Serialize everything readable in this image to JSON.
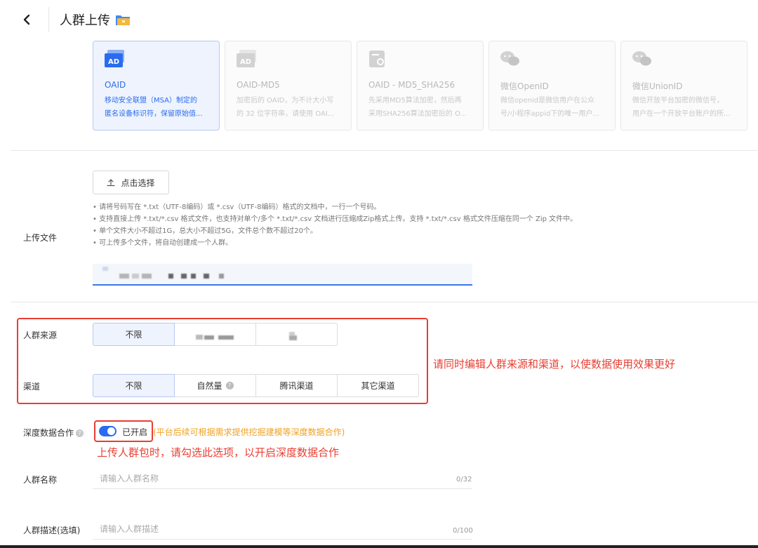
{
  "header": {
    "title": "人群上传"
  },
  "id_types": [
    {
      "title": "OAID",
      "desc": "移动安全联盟（MSA）制定的\n匿名设备标识符，保留原始值...",
      "selected": true
    },
    {
      "title": "OAID-MD5",
      "desc": "加密后的 OAID，为不计大小写\n的 32 位字符串，请使用 OAI...",
      "selected": false
    },
    {
      "title": "OAID - MD5_SHA256",
      "desc": "先采用MD5算法加密，然后再\n采用SHA256算法加密后的 O...",
      "selected": false
    },
    {
      "title": "微信OpenID",
      "desc": "微信openid是微信用户在公众\n号/小程序appid下的唯一用户...",
      "selected": false
    },
    {
      "title": "微信UnionID",
      "desc": "微信开放平台加密的微信号，\n用户在一个开放平台账户的所...",
      "selected": false
    }
  ],
  "upload": {
    "label": "上传文件",
    "button_label": "点击选择",
    "tips": [
      "• 请将号码写在 *.txt（UTF-8编码）或 *.csv（UTF-8编码）格式的文档中，一行一个号码。",
      "• 支持直接上传 *.txt/*.csv 格式文件，也支持对单个/多个 *.txt/*.csv 文档进行压缩成Zip格式上传。支持 *.txt/*.csv 格式文件压缩在同一个 Zip 文件中。",
      "• 单个文件大小不超过1G，总大小不超过5G，文件总个数不超过20个。",
      "• 可上传多个文件，将自动创建成一个人群。"
    ]
  },
  "source": {
    "label": "人群来源",
    "options": [
      "不限",
      "",
      ""
    ]
  },
  "channel": {
    "label": "渠道",
    "options": [
      "不限",
      "自然量",
      "腾讯渠道",
      "其它渠道"
    ]
  },
  "annotations": {
    "source_channel_note": "请同时编辑人群来源和渠道，以使数据使用效果更好",
    "deep_coop_note": "上传人群包时，请勾选此选项，以开启深度数据合作"
  },
  "deep_coop": {
    "label": "深度数据合作",
    "toggle_label": "已开启",
    "toggle_on": true,
    "hint": "(平台后续可根据需求提供挖掘建模等深度数据合作)"
  },
  "name_field": {
    "label": "人群名称",
    "placeholder": "请输入人群名称",
    "value": "",
    "counter": "0/32"
  },
  "desc_field": {
    "label": "人群描述(选填)",
    "placeholder": "请输入人群描述",
    "value": "",
    "counter": "0/100"
  },
  "colors": {
    "accent": "#2a6cf0",
    "annotation_red": "#e83e32",
    "hint_orange": "#f0a020"
  }
}
